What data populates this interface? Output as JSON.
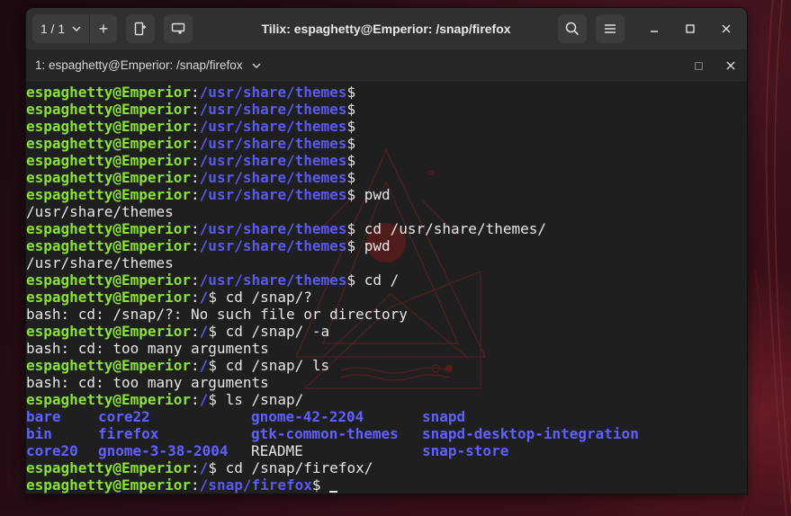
{
  "window": {
    "title": "Tilix: espaghetty@Emperior: /snap/firefox",
    "session_counter": "1 / 1",
    "add_label": "+"
  },
  "tab": {
    "title": "1: espaghetty@Emperior: /snap/firefox"
  },
  "prompt": {
    "user_host": "espaghetty@Emperior",
    "separator": ":",
    "dollar": "$"
  },
  "terminal": {
    "lines": [
      {
        "type": "prompt",
        "path": "/usr/share/themes",
        "cmd": ""
      },
      {
        "type": "prompt",
        "path": "/usr/share/themes",
        "cmd": ""
      },
      {
        "type": "prompt",
        "path": "/usr/share/themes",
        "cmd": ""
      },
      {
        "type": "prompt",
        "path": "/usr/share/themes",
        "cmd": ""
      },
      {
        "type": "prompt",
        "path": "/usr/share/themes",
        "cmd": ""
      },
      {
        "type": "prompt",
        "path": "/usr/share/themes",
        "cmd": ""
      },
      {
        "type": "prompt",
        "path": "/usr/share/themes",
        "cmd": " pwd"
      },
      {
        "type": "output",
        "text": "/usr/share/themes"
      },
      {
        "type": "prompt",
        "path": "/usr/share/themes",
        "cmd": " cd /usr/share/themes/"
      },
      {
        "type": "prompt",
        "path": "/usr/share/themes",
        "cmd": " pwd"
      },
      {
        "type": "output",
        "text": "/usr/share/themes"
      },
      {
        "type": "prompt",
        "path": "/usr/share/themes",
        "cmd": " cd /"
      },
      {
        "type": "prompt",
        "path": "/",
        "cmd": " cd /snap/?"
      },
      {
        "type": "output",
        "text": "bash: cd: /snap/?: No such file or directory"
      },
      {
        "type": "prompt",
        "path": "/",
        "cmd": " cd /snap/ -a"
      },
      {
        "type": "output",
        "text": "bash: cd: too many arguments"
      },
      {
        "type": "prompt",
        "path": "/",
        "cmd": " cd /snap/ ls"
      },
      {
        "type": "output",
        "text": "bash: cd: too many arguments"
      },
      {
        "type": "prompt",
        "path": "/",
        "cmd": " ls /snap/"
      }
    ],
    "ls_rows": [
      [
        {
          "text": "bare",
          "kind": "dir"
        },
        {
          "text": "core22",
          "kind": "dir"
        },
        {
          "text": "gnome-42-2204",
          "kind": "dir"
        },
        {
          "text": "snapd",
          "kind": "dir"
        }
      ],
      [
        {
          "text": "bin",
          "kind": "dir"
        },
        {
          "text": "firefox",
          "kind": "dir"
        },
        {
          "text": "gtk-common-themes",
          "kind": "dir"
        },
        {
          "text": "snapd-desktop-integration",
          "kind": "dir"
        }
      ],
      [
        {
          "text": "core20",
          "kind": "dir"
        },
        {
          "text": "gnome-3-38-2004",
          "kind": "dir"
        },
        {
          "text": "README",
          "kind": "file"
        },
        {
          "text": "snap-store",
          "kind": "dir"
        }
      ]
    ],
    "after_lines": [
      {
        "type": "prompt",
        "path": "/",
        "cmd": " cd /snap/firefox/"
      },
      {
        "type": "prompt",
        "path": "/snap/firefox",
        "cmd": " ",
        "cursor": true
      }
    ]
  },
  "colors": {
    "prompt_user": "#8ae234",
    "prompt_path": "#5a5aef",
    "ls_dir": "#6060ff",
    "terminal_bg": "#1f1f1f",
    "titlebar_bg": "#303030"
  },
  "icons": {
    "counter_dropdown": "chevron-down-icon",
    "add_session": "plus-icon",
    "add_terminal_right": "add-terminal-right-icon",
    "add_terminal_down": "add-terminal-down-icon",
    "search": "search-icon",
    "menu": "hamburger-menu-icon",
    "minimize": "minimize-icon",
    "maximize": "maximize-icon",
    "close": "close-icon",
    "tab_dropdown": "chevron-down-icon",
    "tab_maximize": "tab-maximize-icon",
    "tab_close": "tab-close-icon"
  }
}
